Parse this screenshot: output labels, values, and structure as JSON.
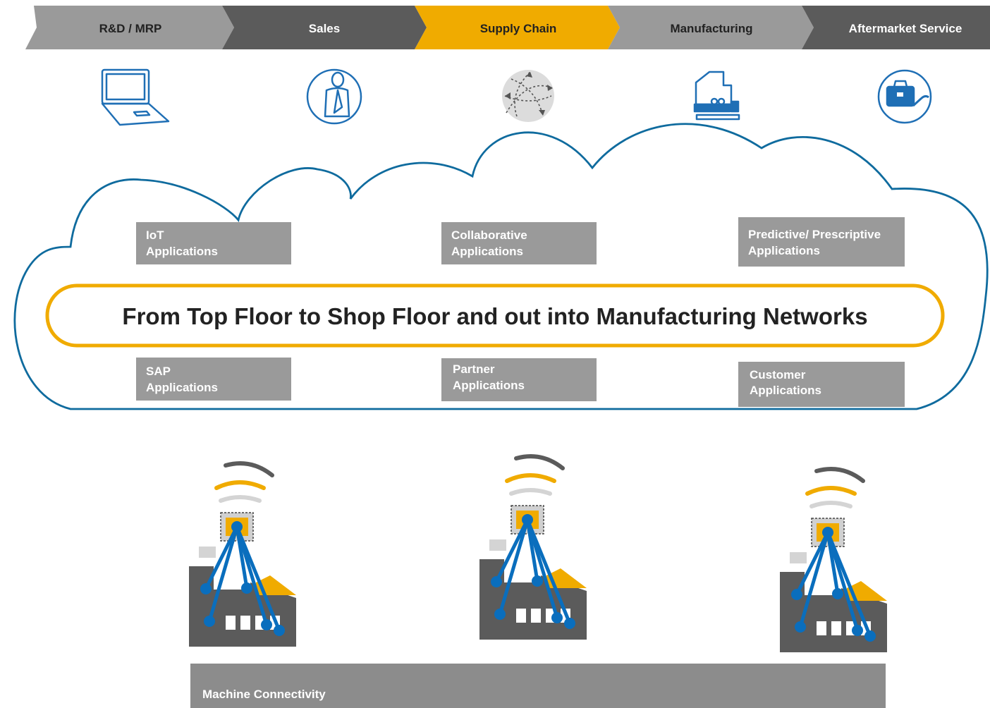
{
  "value_chain": {
    "stages": [
      {
        "label": "R&D / MRP",
        "fill": "#9a9a9a",
        "text_color": "#222222",
        "icon": "laptop-icon"
      },
      {
        "label": "Sales",
        "fill": "#5b5b5b",
        "text_color": "#ffffff",
        "icon": "businessman-icon"
      },
      {
        "label": "Supply Chain",
        "fill": "#f0ab00",
        "text_color": "#222222",
        "icon": "globe-network-icon"
      },
      {
        "label": "Manufacturing",
        "fill": "#9a9a9a",
        "text_color": "#222222",
        "icon": "factory-machine-icon"
      },
      {
        "label": "Aftermarket Service",
        "fill": "#5b5b5b",
        "text_color": "#ffffff",
        "icon": "toolbox-icon"
      }
    ]
  },
  "cloud": {
    "headline": "From Top Floor to Shop Floor and out into Manufacturing Networks",
    "outline_color": "#0f6b9e",
    "highlight_color": "#f0ab00",
    "boxes": [
      {
        "line1": "IoT",
        "line2": "Applications"
      },
      {
        "line1": "Collaborative",
        "line2": "Applications"
      },
      {
        "line1": "Predictive/ Prescriptive",
        "line2": "Applications"
      },
      {
        "line1": "SAP",
        "line2": "Applications"
      },
      {
        "line1": "Partner",
        "line2": "Applications"
      },
      {
        "line1": "Customer",
        "line2": "Applications"
      }
    ]
  },
  "factories": {
    "count": 3,
    "icon": "connected-factory-icon",
    "accent_color": "#f0ab00",
    "line_color": "#0a6ebd"
  },
  "connectivity": {
    "label": "Machine Connectivity",
    "fill": "#8c8c8c"
  }
}
